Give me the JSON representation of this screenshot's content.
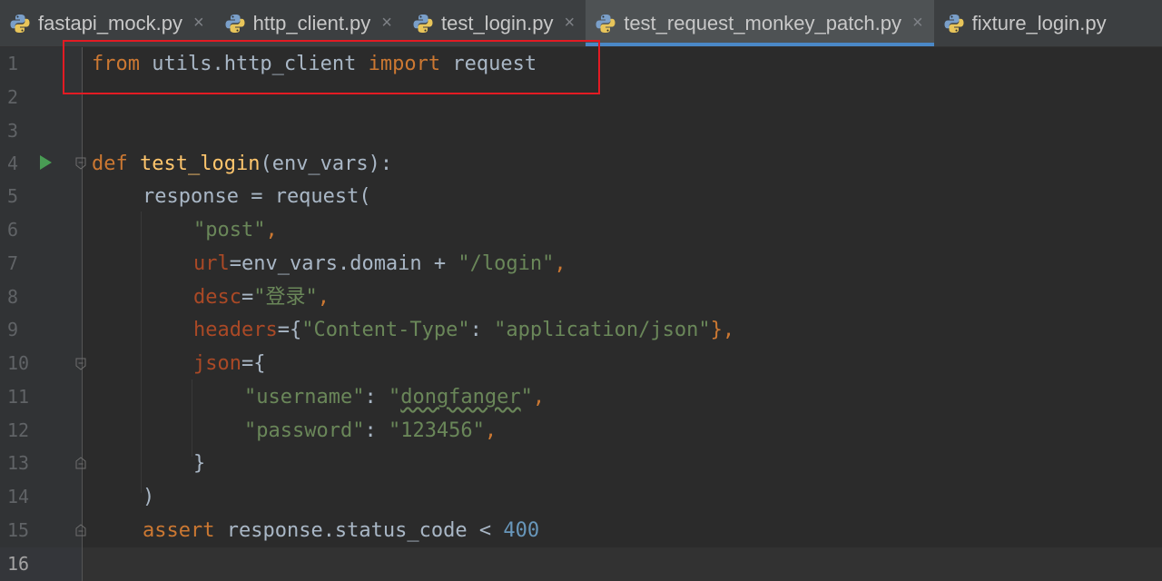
{
  "tabs": [
    {
      "label": "fastapi_mock.py",
      "active": false,
      "icon": "python-file-icon"
    },
    {
      "label": "http_client.py",
      "active": false,
      "icon": "python-file-icon"
    },
    {
      "label": "test_login.py",
      "active": false,
      "icon": "python-file-icon"
    },
    {
      "label": "test_request_monkey_patch.py",
      "active": true,
      "icon": "python-file-icon"
    },
    {
      "label": "fixture_login.py",
      "active": false,
      "icon": "python-file-icon"
    }
  ],
  "close_glyph": "×",
  "line_numbers": [
    "1",
    "2",
    "3",
    "4",
    "5",
    "6",
    "7",
    "8",
    "9",
    "10",
    "11",
    "12",
    "13",
    "14",
    "15",
    "16"
  ],
  "code": {
    "l1": {
      "kw1": "from",
      "mod": " utils.http_client ",
      "kw2": "import",
      "name": " request"
    },
    "l4": {
      "kw": "def",
      "fn": "test_login",
      "rest": "(env_vars):"
    },
    "l5": {
      "text": "response = request("
    },
    "l6": {
      "str": "\"post\"",
      "punc": ","
    },
    "l7": {
      "param": "url",
      "mid": "=env_vars.domain + ",
      "str": "\"/login\"",
      "punc": ","
    },
    "l8": {
      "param": "desc",
      "eq": "=",
      "str": "\"登录\"",
      "punc": ","
    },
    "l9": {
      "param": "headers",
      "open": "={",
      "key": "\"Content-Type\"",
      "colon": ": ",
      "val": "\"application/json\"",
      "close": "},"
    },
    "l10": {
      "param": "json",
      "open": "={"
    },
    "l11": {
      "key": "\"username\"",
      "colon": ": ",
      "q1": "\"",
      "val": "dongfanger",
      "q2": "\"",
      "punc": ","
    },
    "l12": {
      "key": "\"password\"",
      "colon": ": ",
      "val": "\"123456\"",
      "punc": ","
    },
    "l13": {
      "text": "}"
    },
    "l14": {
      "text": ")"
    },
    "l15": {
      "kw": "assert",
      "mid": " response.status_code < ",
      "num": "400"
    }
  },
  "colors": {
    "keyword": "#cc7832",
    "function": "#ffc66d",
    "string": "#6a8759",
    "number": "#6897bb",
    "param": "#aa4926",
    "highlight_box": "#e31b23",
    "tab_accent": "#4a88c7"
  }
}
